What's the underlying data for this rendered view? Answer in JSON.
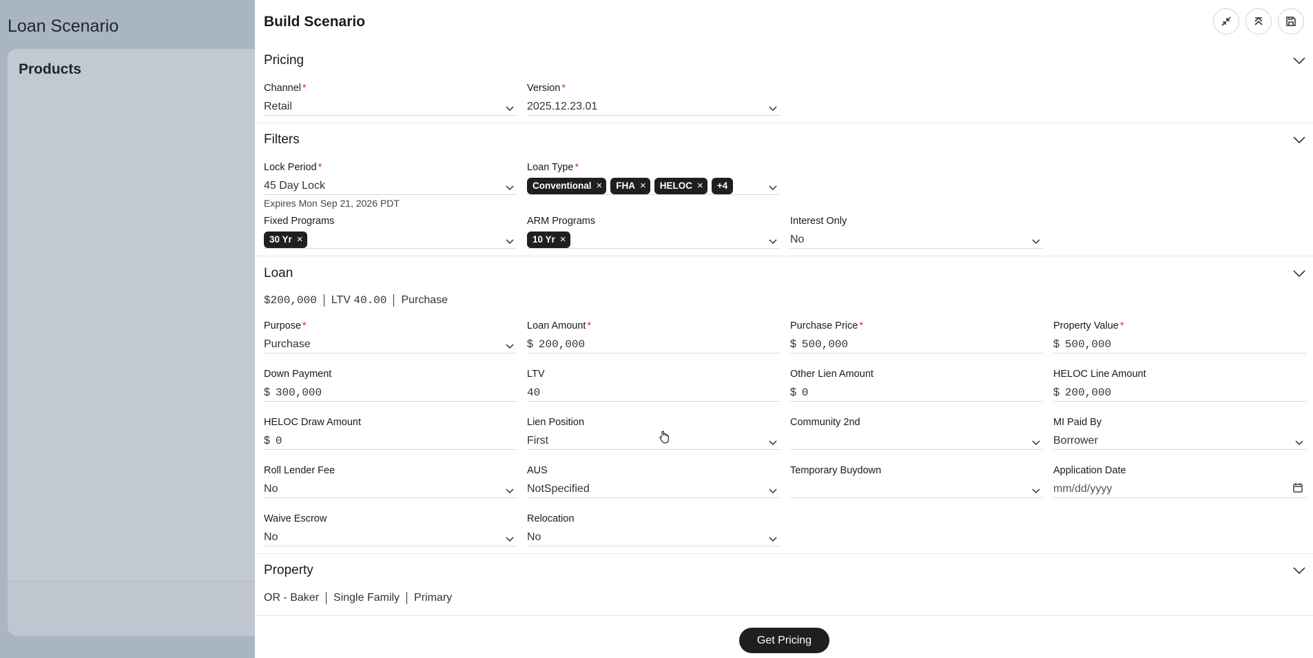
{
  "background": {
    "title": "Loan Scenario",
    "card_title": "Products"
  },
  "drawer": {
    "title": "Build Scenario",
    "header_buttons": [
      "collapse-icon",
      "collapse-all-icon",
      "save-icon"
    ]
  },
  "pricing": {
    "title": "Pricing",
    "channel": {
      "label": "Channel",
      "value": "Retail"
    },
    "version": {
      "label": "Version",
      "value": "2025.12.23.01"
    }
  },
  "filters": {
    "title": "Filters",
    "lock_period": {
      "label": "Lock Period",
      "value": "45 Day Lock",
      "sub": "Expires Mon Sep 21, 2026 PDT"
    },
    "loan_type": {
      "label": "Loan Type",
      "chips": [
        "Conventional",
        "FHA",
        "HELOC"
      ],
      "more": "+4"
    },
    "fixed_programs": {
      "label": "Fixed Programs",
      "chips": [
        "30 Yr"
      ]
    },
    "arm_programs": {
      "label": "ARM Programs",
      "chips": [
        "10 Yr"
      ]
    },
    "interest_only": {
      "label": "Interest Only",
      "value": "No"
    }
  },
  "loan": {
    "title": "Loan",
    "summary": {
      "amount": "$200,000",
      "ltv_label": "LTV",
      "ltv_value": "40.00",
      "purpose": "Purchase"
    },
    "purpose": {
      "label": "Purpose",
      "value": "Purchase"
    },
    "loan_amount": {
      "label": "Loan Amount",
      "prefix": "$",
      "value": "200,000"
    },
    "purchase_price": {
      "label": "Purchase Price",
      "prefix": "$",
      "value": "500,000"
    },
    "property_value": {
      "label": "Property Value",
      "prefix": "$",
      "value": "500,000"
    },
    "down_payment": {
      "label": "Down Payment",
      "prefix": "$",
      "value": "300,000"
    },
    "ltv": {
      "label": "LTV",
      "value": "40"
    },
    "other_lien": {
      "label": "Other Lien Amount",
      "prefix": "$",
      "value": "0"
    },
    "heloc_line": {
      "label": "HELOC Line Amount",
      "prefix": "$",
      "value": "200,000"
    },
    "heloc_draw": {
      "label": "HELOC Draw Amount",
      "prefix": "$",
      "value": "0"
    },
    "lien_position": {
      "label": "Lien Position",
      "value": "First"
    },
    "community_2nd": {
      "label": "Community 2nd",
      "value": ""
    },
    "mi_paid_by": {
      "label": "MI Paid By",
      "value": "Borrower"
    },
    "roll_lender_fee": {
      "label": "Roll Lender Fee",
      "value": "No"
    },
    "aus": {
      "label": "AUS",
      "value": "NotSpecified"
    },
    "temp_buydown": {
      "label": "Temporary Buydown",
      "value": ""
    },
    "application_date": {
      "label": "Application Date",
      "placeholder": "mm/dd/yyyy"
    },
    "waive_escrow": {
      "label": "Waive Escrow",
      "value": "No"
    },
    "relocation": {
      "label": "Relocation",
      "value": "No"
    }
  },
  "property": {
    "title": "Property",
    "summary": [
      "OR - Baker",
      "Single Family",
      "Primary"
    ]
  },
  "footer": {
    "get_pricing": "Get Pricing"
  },
  "required_mark": "*",
  "chip_remove": "×",
  "summary_sep": "|"
}
